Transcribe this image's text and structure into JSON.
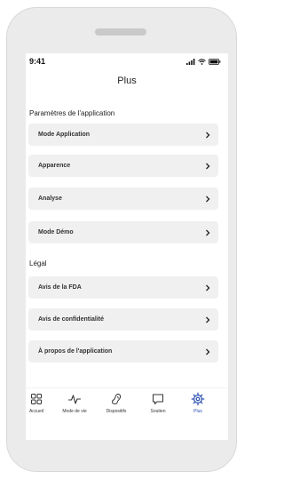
{
  "status": {
    "time": "9:41"
  },
  "header": {
    "title": "Plus"
  },
  "sections": [
    {
      "title": "Paramètres de l'application",
      "items": [
        {
          "label": "Mode Application"
        },
        {
          "label": "Apparence"
        },
        {
          "label": "Analyse"
        },
        {
          "label": "Mode Démo"
        }
      ]
    },
    {
      "title": "Légal",
      "items": [
        {
          "label": "Avis de la FDA"
        },
        {
          "label": "Avis de confidentialité"
        },
        {
          "label": "À propos de l'application"
        }
      ]
    }
  ],
  "tabbar": {
    "active_color": "#2a4fb0",
    "tabs": [
      {
        "label": "Accueil",
        "icon": "grid-icon"
      },
      {
        "label": "Mode de vie",
        "icon": "activity-icon"
      },
      {
        "label": "Dispositifs",
        "icon": "hearing-aid-icon"
      },
      {
        "label": "Soutien",
        "icon": "chat-bubble-icon"
      },
      {
        "label": "Plus",
        "icon": "gear-icon",
        "active": true
      }
    ]
  }
}
